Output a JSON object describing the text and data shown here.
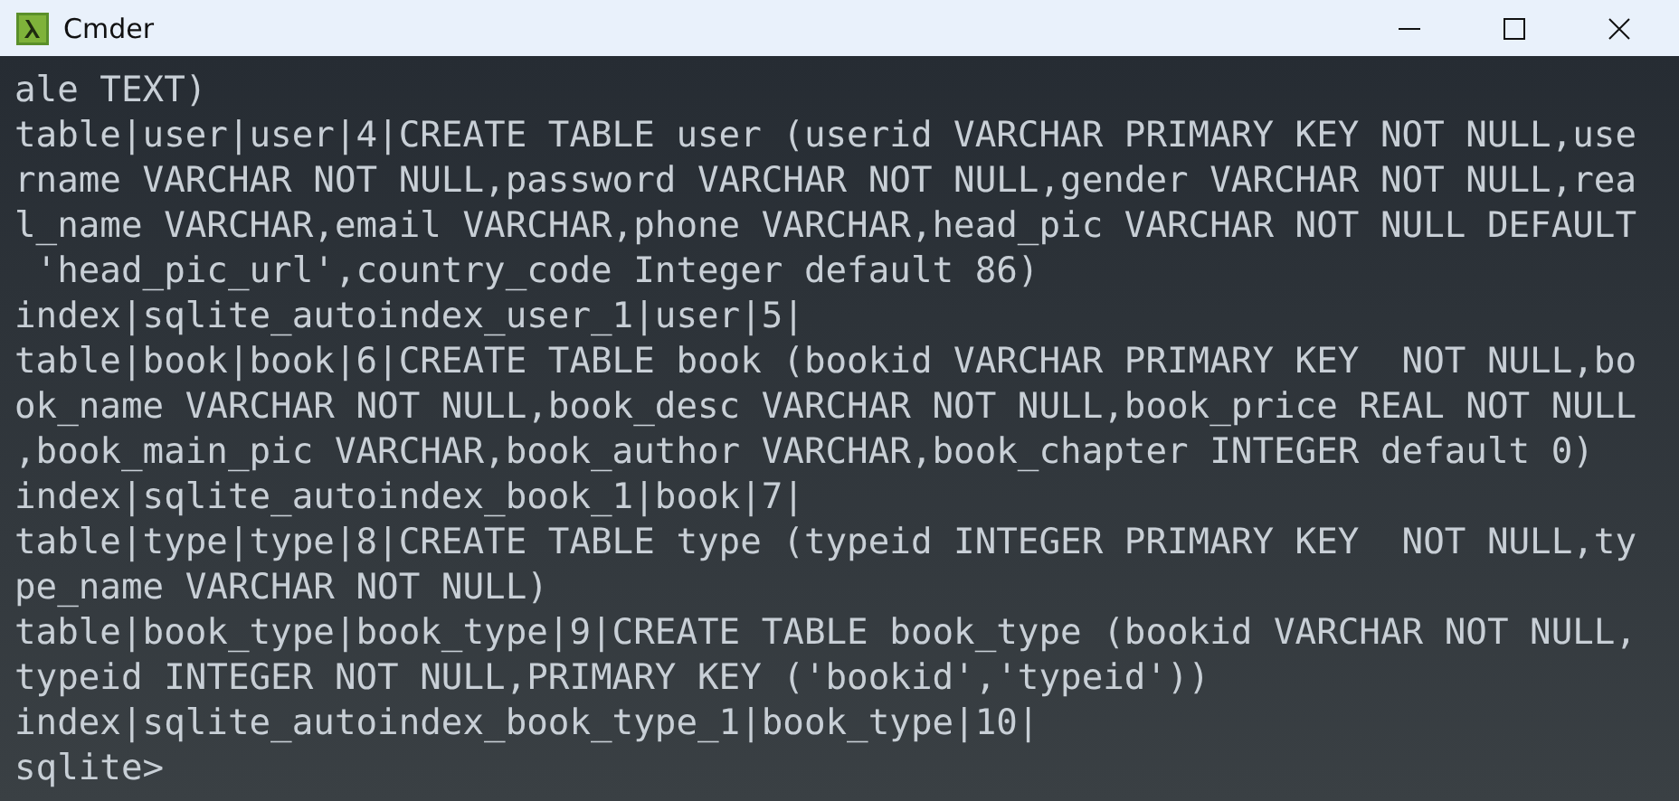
{
  "window": {
    "title": "Cmder"
  },
  "console": {
    "lines": [
      "ale TEXT)",
      "table|user|user|4|CREATE TABLE user (userid VARCHAR PRIMARY KEY NOT NULL,use",
      "rname VARCHAR NOT NULL,password VARCHAR NOT NULL,gender VARCHAR NOT NULL,rea",
      "l_name VARCHAR,email VARCHAR,phone VARCHAR,head_pic VARCHAR NOT NULL DEFAULT",
      " 'head_pic_url',country_code Integer default 86)",
      "index|sqlite_autoindex_user_1|user|5|",
      "table|book|book|6|CREATE TABLE book (bookid VARCHAR PRIMARY KEY  NOT NULL,bo",
      "ok_name VARCHAR NOT NULL,book_desc VARCHAR NOT NULL,book_price REAL NOT NULL",
      ",book_main_pic VARCHAR,book_author VARCHAR,book_chapter INTEGER default 0)",
      "index|sqlite_autoindex_book_1|book|7|",
      "table|type|type|8|CREATE TABLE type (typeid INTEGER PRIMARY KEY  NOT NULL,ty",
      "pe_name VARCHAR NOT NULL)",
      "table|book_type|book_type|9|CREATE TABLE book_type (bookid VARCHAR NOT NULL,",
      "typeid INTEGER NOT NULL,PRIMARY KEY ('bookid','typeid'))",
      "index|sqlite_autoindex_book_type_1|book_type|10|",
      "sqlite>"
    ]
  }
}
